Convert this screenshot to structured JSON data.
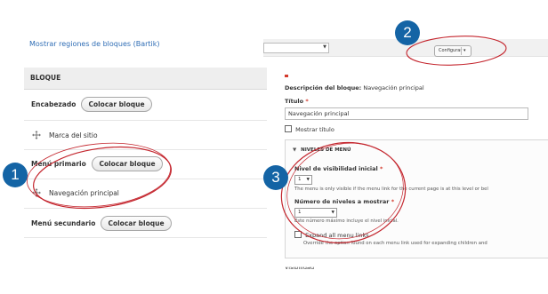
{
  "left_panel": {
    "region_link": "Mostrar regiones de bloques (Bartik)",
    "table_header": "BLOQUE",
    "rows": [
      {
        "label": "Encabezado",
        "button": "Colocar bloque"
      },
      {
        "item": "Marca del sitio"
      },
      {
        "label": "Menú primario",
        "button": "Colocar bloque"
      },
      {
        "item": "Navegación principal"
      },
      {
        "label": "Menú secundario",
        "button": "Colocar bloque"
      }
    ]
  },
  "right_panel": {
    "configure_button": "Configurar",
    "description_label": "Descripción del bloque:",
    "description_value": "Navegación principal",
    "title_label": "Título",
    "required_mark": "*",
    "title_value": "Navegación principal",
    "show_title": "Mostrar título",
    "fieldset_title": "NIVELES DE MENÚ",
    "initial_level_label": "Nivel de visibilidad inicial",
    "initial_level_value": "1",
    "initial_level_help": "The menu is only visible if the menu link for the current page is at this level or bel",
    "levels_label": "Número de niveles a mostrar",
    "levels_value": "1",
    "levels_help": "Este número máximo incluye el nivel inicial.",
    "expand_label": "Expand all menu links",
    "expand_help": "Override the option found on each menu link used for expanding children and",
    "visibility_label": "Visibilidad"
  },
  "callouts": [
    "1",
    "2",
    "3"
  ],
  "colors": {
    "callout": "#1464a5",
    "ring": "#c4262e",
    "link": "#2f6db5",
    "required": "#d43a2c"
  }
}
